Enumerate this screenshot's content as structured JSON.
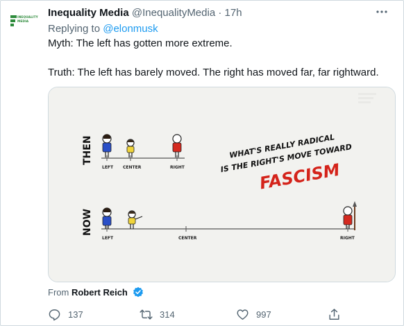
{
  "tweet": {
    "display_name": "Inequality Media",
    "handle": "@InequalityMedia",
    "separator": "·",
    "time": "17h",
    "more_icon": "ellipsis-icon",
    "avatar_logo_line1": "INEQUALITY",
    "avatar_logo_line2": "MEDIA",
    "replying_prefix": "Replying to",
    "replying_to": "@elonmusk",
    "text_line1": "Myth: The left has gotten more extreme.",
    "text_line2": "Truth: The left has barely moved. The right has moved far, far rightward.",
    "media": {
      "row1_label": "THEN",
      "row2_label": "NOW",
      "then_left": "LEFT",
      "then_center": "CENTER",
      "then_right": "RIGHT",
      "now_left": "LEFT",
      "now_center": "CENTER",
      "now_right": "RIGHT",
      "headline_1": "WHAT'S REALLY RADICAL",
      "headline_2": "IS THE RIGHT'S MOVE TOWARD",
      "headline_3": "FASCISM",
      "headline_color": "#111111",
      "accent_color": "#d4231a"
    },
    "from_prefix": "From",
    "from_author": "Robert Reich",
    "verified_icon": "verified-badge-icon"
  },
  "actions": {
    "reply_count": "137",
    "retweet_count": "314",
    "like_count": "997",
    "reply_icon": "reply-icon",
    "retweet_icon": "retweet-icon",
    "like_icon": "heart-icon",
    "share_icon": "share-icon"
  },
  "colors": {
    "link": "#1d9bf0",
    "secondary": "#536471",
    "primary_text": "#0f1419",
    "logo_green": "#2e8b3c"
  }
}
